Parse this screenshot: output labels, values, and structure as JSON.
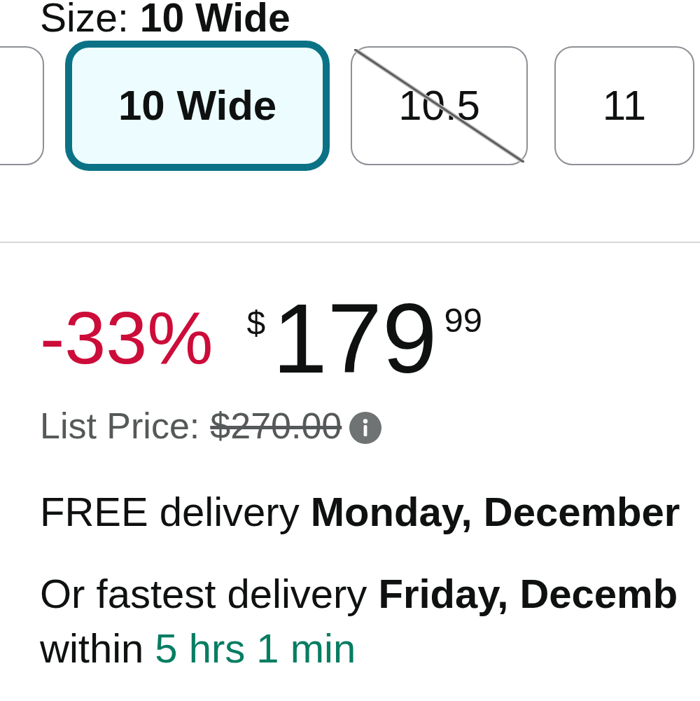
{
  "size_selector": {
    "label": "Size:",
    "value": "10 Wide",
    "options": [
      {
        "selected": false,
        "available": true
      },
      {
        "label": "10 Wide",
        "selected": true,
        "available": true
      },
      {
        "label": "10.5",
        "selected": false,
        "available": false
      },
      {
        "label": "11",
        "selected": false,
        "available": true
      }
    ]
  },
  "price": {
    "discount": "-33%",
    "currency_symbol": "$",
    "whole": "179",
    "fraction": "99",
    "list_price_label": "List Price:",
    "list_price": "$270.00"
  },
  "delivery": {
    "free_delivery": "FREE delivery **Monday, December**",
    "fastest_delivery": "Or fastest delivery **Friday, Decemb**",
    "order_within_label": "within",
    "countdown": "5 hrs 1 min"
  }
}
